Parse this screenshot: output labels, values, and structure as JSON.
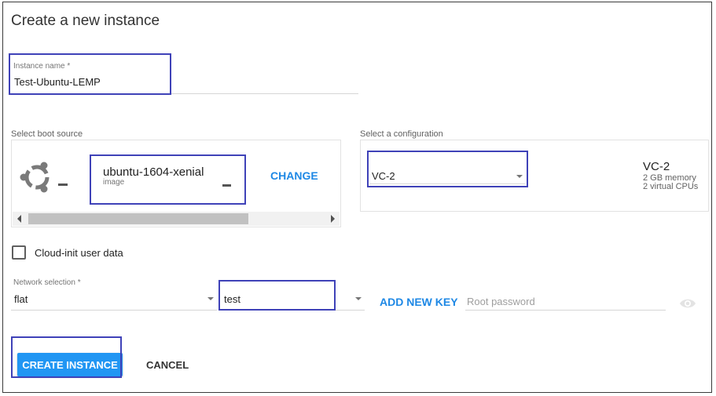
{
  "page": {
    "title": "Create a new instance"
  },
  "instance_name": {
    "label": "Instance name *",
    "value": "Test-Ubuntu-LEMP"
  },
  "boot_source": {
    "label": "Select boot source",
    "image_name": "ubuntu-1604-xenial",
    "image_type": "image",
    "change_label": "CHANGE",
    "icon": "ubuntu-logo-icon"
  },
  "configuration": {
    "label": "Select a configuration",
    "selected": "VC-2",
    "name": "VC-2",
    "memory": "2 GB memory",
    "cpus": "2 virtual CPUs"
  },
  "cloud_init": {
    "label": "Cloud-init user data",
    "checked": false
  },
  "network": {
    "label": "Network selection *",
    "value": "flat"
  },
  "key": {
    "value": "test",
    "add_label": "ADD NEW KEY"
  },
  "password": {
    "placeholder": "Root password",
    "icon": "eye-icon"
  },
  "actions": {
    "create_label": "CREATE INSTANCE",
    "cancel_label": "CANCEL"
  },
  "colors": {
    "accent": "#1e88e5",
    "primary_button": "#2196f3",
    "highlight_box": "#3f42b8"
  }
}
